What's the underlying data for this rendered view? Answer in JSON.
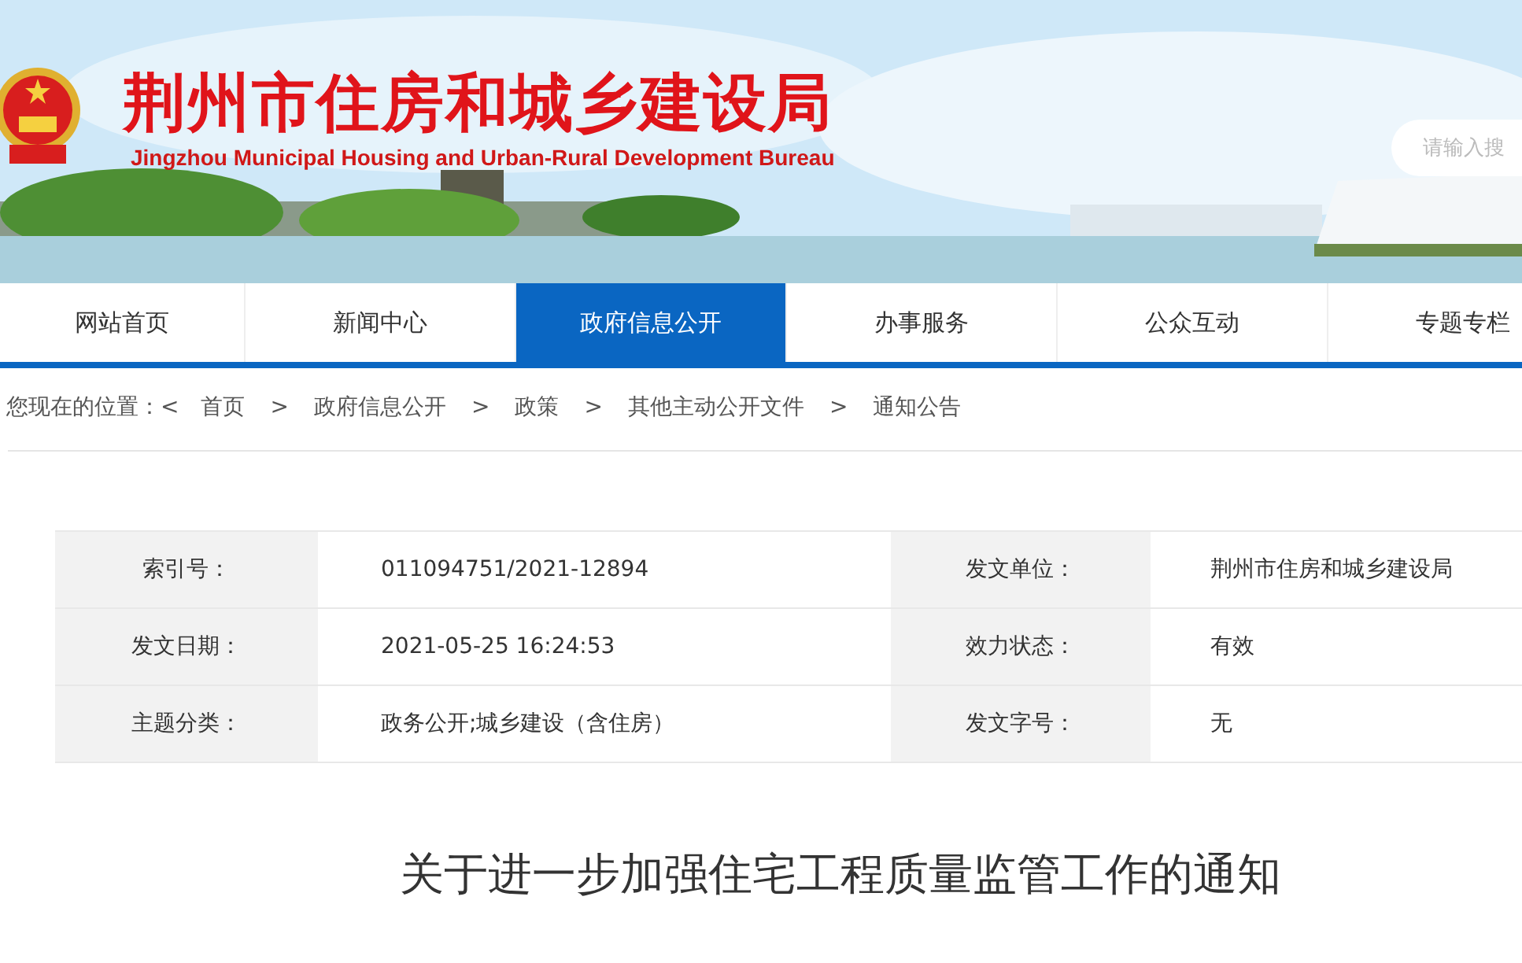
{
  "header": {
    "title": "荆州市住房和城乡建设局",
    "subtitle": "Jingzhou Municipal Housing and Urban-Rural Development Bureau",
    "search": {
      "placeholder": "请输入搜"
    }
  },
  "nav": [
    {
      "label": "网站首页",
      "selected": false
    },
    {
      "label": "新闻中心",
      "selected": false
    },
    {
      "label": "政府信息公开",
      "selected": true
    },
    {
      "label": "办事服务",
      "selected": false
    },
    {
      "label": "公众互动",
      "selected": false
    },
    {
      "label": "专题专栏",
      "selected": false
    }
  ],
  "breadcrumb": {
    "prefix": "您现在的位置：<",
    "items": [
      "首页",
      "政府信息公开",
      "政策",
      "其他主动公开文件",
      "通知公告"
    ],
    "separator": ">"
  },
  "meta": [
    {
      "label_1": "索引号：",
      "value_1": "011094751/2021-12894",
      "label_2": "发文单位：",
      "value_2": "荆州市住房和城乡建设局"
    },
    {
      "label_1": "发文日期：",
      "value_1": "2021-05-25 16:24:53",
      "label_2": "效力状态：",
      "value_2": "有效"
    },
    {
      "label_1": "主题分类：",
      "value_1": "政务公开;城乡建设（含住房）",
      "label_2": "发文字号：",
      "value_2": "无"
    }
  ],
  "article": {
    "title": "关于进一步加强住宅工程质量监管工作的通知"
  }
}
